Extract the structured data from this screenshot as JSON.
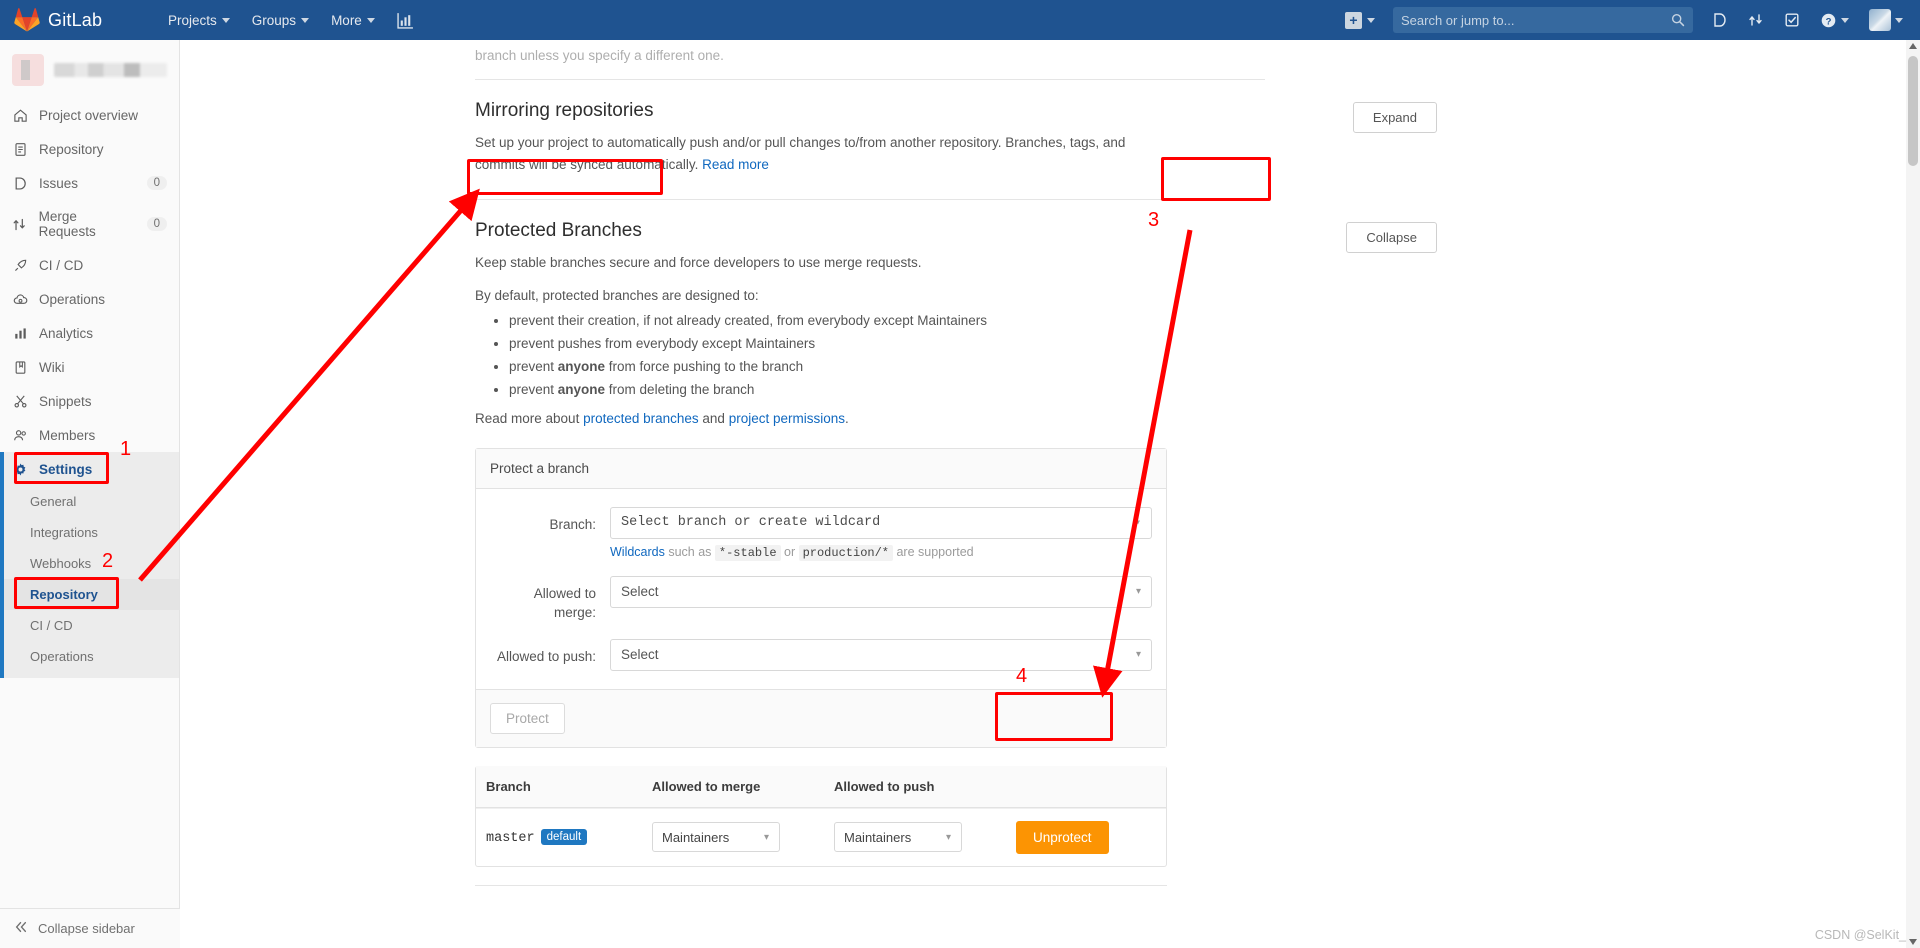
{
  "topnav": {
    "brand": "GitLab",
    "items": [
      {
        "label": "Projects",
        "icon": "chevron-down-icon"
      },
      {
        "label": "Groups",
        "icon": "chevron-down-icon"
      },
      {
        "label": "More",
        "icon": "chevron-down-icon"
      }
    ],
    "analytics_icon": "chart-bar-icon",
    "new_icon": "plus-square-icon",
    "search": {
      "placeholder": "Search or jump to...",
      "value": "",
      "icon": "search-icon"
    },
    "right_icons": [
      "issues-icon",
      "merge-requests-icon",
      "todos-icon",
      "help-icon",
      "user-avatar"
    ]
  },
  "sidebar": {
    "project_name": "",
    "items": [
      {
        "label": "Project overview",
        "icon": "home-icon",
        "count": ""
      },
      {
        "label": "Repository",
        "icon": "document-icon",
        "count": ""
      },
      {
        "label": "Issues",
        "icon": "issues-icon",
        "count": "0"
      },
      {
        "label": "Merge Requests",
        "icon": "merge-requests-icon",
        "count": "0"
      },
      {
        "label": "CI / CD",
        "icon": "rocket-icon",
        "count": ""
      },
      {
        "label": "Operations",
        "icon": "cloud-gear-icon",
        "count": ""
      },
      {
        "label": "Analytics",
        "icon": "chart-bar-icon",
        "count": ""
      },
      {
        "label": "Wiki",
        "icon": "book-icon",
        "count": ""
      },
      {
        "label": "Snippets",
        "icon": "scissors-icon",
        "count": ""
      },
      {
        "label": "Members",
        "icon": "users-icon",
        "count": ""
      },
      {
        "label": "Settings",
        "icon": "gear-icon",
        "count": ""
      }
    ],
    "settings_subitems": [
      {
        "label": "General"
      },
      {
        "label": "Integrations"
      },
      {
        "label": "Webhooks"
      },
      {
        "label": "Repository"
      },
      {
        "label": "CI / CD"
      },
      {
        "label": "Operations"
      }
    ],
    "collapse": {
      "label": "Collapse sidebar",
      "icon": "chevron-double-left-icon"
    }
  },
  "main": {
    "cut_off_text": "branch unless you specify a different one.",
    "mirroring": {
      "title": "Mirroring repositories",
      "desc_part1": "Set up your project to automatically push and/or pull changes to/from another repository. Branches, tags, and commits will be synced automatically. ",
      "desc_link": "Read more",
      "button": "Expand"
    },
    "protected": {
      "title": "Protected Branches",
      "subtitle": "Keep stable branches secure and force developers to use merge requests.",
      "intro": "By default, protected branches are designed to:",
      "bullets": [
        {
          "pre": "prevent their creation, if not already created, from everybody except Maintainers",
          "bold": "",
          "post": ""
        },
        {
          "pre": "prevent pushes from everybody except Maintainers",
          "bold": "",
          "post": ""
        },
        {
          "pre": "prevent ",
          "bold": "anyone",
          "post": " from force pushing to the branch"
        },
        {
          "pre": "prevent ",
          "bold": "anyone",
          "post": " from deleting the branch"
        }
      ],
      "readmore_pre": "Read more about ",
      "readmore_link1": "protected branches",
      "readmore_mid": " and ",
      "readmore_link2": "project permissions",
      "readmore_post": ".",
      "button": "Collapse"
    },
    "form": {
      "card_title": "Protect a branch",
      "branch_label": "Branch:",
      "branch_value": "Select branch or create wildcard",
      "hint_link": "Wildcards",
      "hint_mid1": " such as ",
      "hint_code1": "*-stable",
      "hint_mid2": " or ",
      "hint_code2": "production/*",
      "hint_end": " are supported",
      "merge_label": "Allowed to merge:",
      "merge_value": "Select",
      "push_label": "Allowed to push:",
      "push_value": "Select",
      "submit": "Protect"
    },
    "table": {
      "headers": [
        "Branch",
        "Allowed to merge",
        "Allowed to push",
        ""
      ],
      "rows": [
        {
          "branch": "master",
          "badge": "default",
          "allowed_merge": "Maintainers",
          "allowed_push": "Maintainers",
          "action": "Unprotect"
        }
      ]
    }
  },
  "annotations": {
    "color": "#ff0000",
    "markers": [
      {
        "num": "1",
        "target": "sidebar-settings"
      },
      {
        "num": "2",
        "target": "sidebar-repository"
      },
      {
        "num": "3",
        "target": "collapse-button"
      },
      {
        "num": "4",
        "target": "unprotect-button"
      }
    ]
  },
  "watermark": "CSDN @SelKit_"
}
